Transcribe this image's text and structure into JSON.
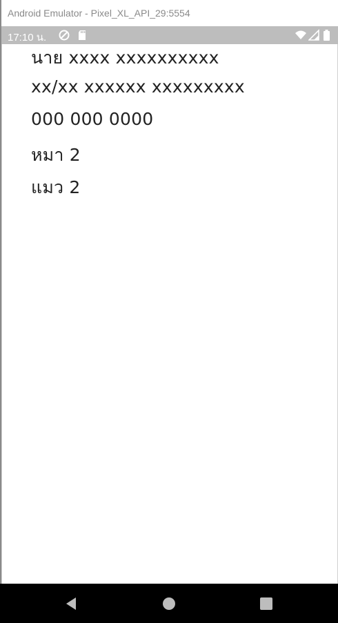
{
  "window": {
    "title": "Android Emulator - Pixel_XL_API_29:5554"
  },
  "statusbar": {
    "time": "17:10 น.",
    "icons": [
      "sync-icon",
      "sd-card-icon",
      "wifi-icon",
      "signal-icon",
      "battery-icon"
    ]
  },
  "content": {
    "lines": [
      "นาย xxxx xxxxxxxxxx",
      "xx/xx xxxxxx xxxxxxxxx",
      "000 000 0000",
      "หมา 2",
      "แมว 2"
    ]
  },
  "navbar": {
    "buttons": [
      "back-icon",
      "home-icon",
      "recents-icon"
    ]
  },
  "colors": {
    "statusbar_bg": "#bdbdbd",
    "navbar_bg": "#000000",
    "title_text": "#8a8a8a",
    "content_text": "#222222"
  }
}
